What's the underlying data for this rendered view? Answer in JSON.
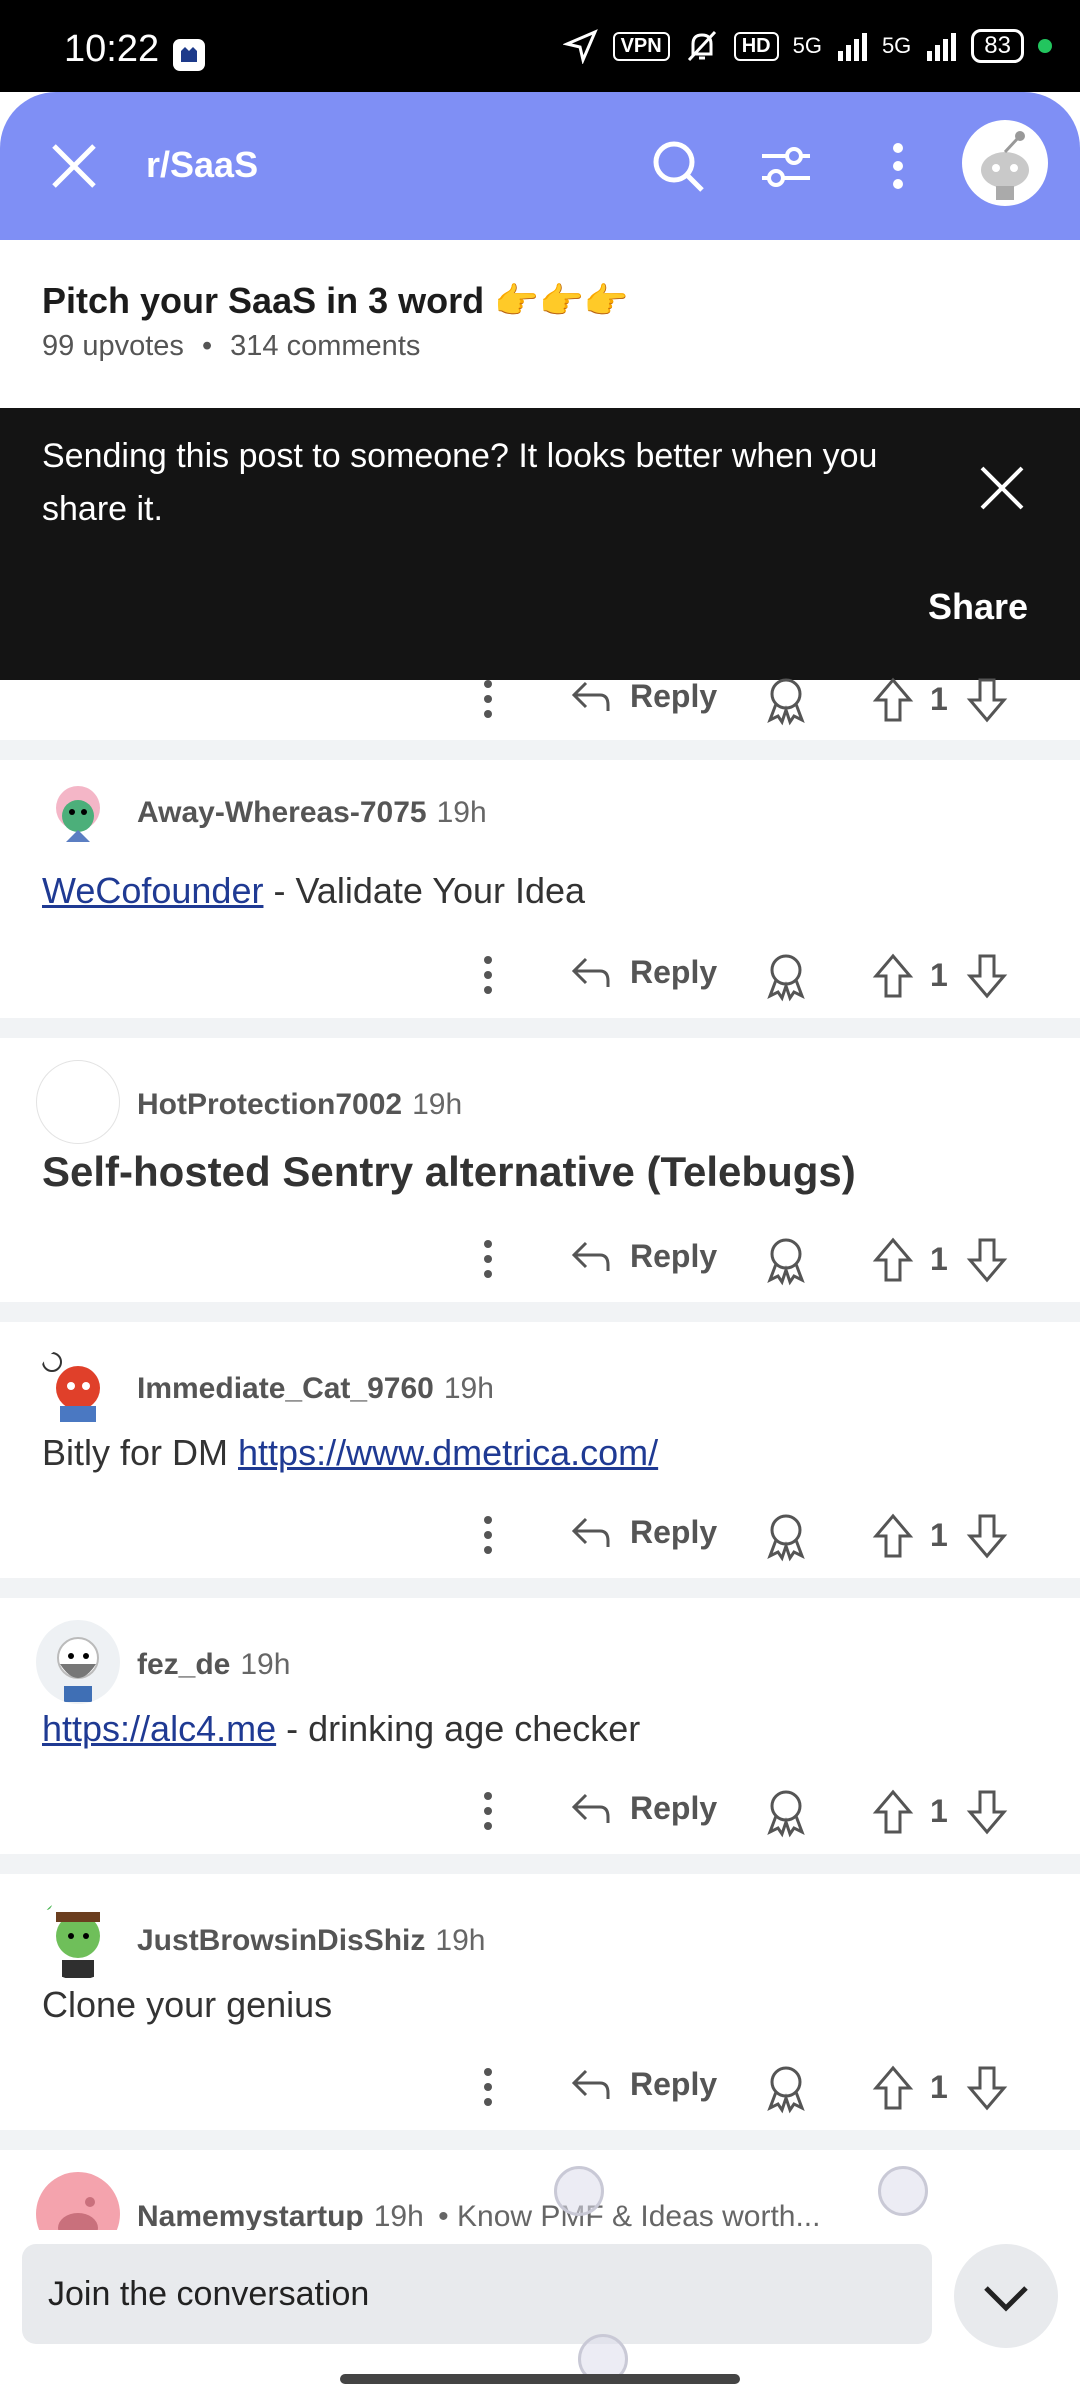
{
  "status_bar": {
    "time": "10:22",
    "vpn": "VPN",
    "hd": "HD",
    "network": "5G",
    "battery": "83"
  },
  "header": {
    "title": "r/SaaS",
    "accent_color": "#7f8ff5"
  },
  "post": {
    "title": "Pitch your SaaS in 3 word",
    "title_emoji": "👉👉👉",
    "upvotes": "99 upvotes",
    "separator": "•",
    "comments": "314 comments"
  },
  "toast": {
    "message": "Sending this post to someone? It looks better when you share it.",
    "share_label": "Share"
  },
  "actions": {
    "reply_label": "Reply"
  },
  "comments": [
    {
      "username": "",
      "time": "",
      "body": "",
      "score": "1"
    },
    {
      "username": "Away-Whereas-7075",
      "time": "19h",
      "body_link": "WeCofounder",
      "body_text": " - Validate Your Idea",
      "score": "1"
    },
    {
      "username": "HotProtection7002",
      "time": "19h",
      "body": "Self-hosted Sentry alternative (Telebugs)",
      "score": "1"
    },
    {
      "username": "Immediate_Cat_9760",
      "time": "19h",
      "body_text": "Bitly for DM ",
      "body_link": "https://www.dmetrica.com/",
      "score": "1"
    },
    {
      "username": "fez_de",
      "time": "19h",
      "body_link": "https://alc4.me",
      "body_text": " - drinking age checker",
      "score": "1"
    },
    {
      "username": "JustBrowsinDisShiz",
      "time": "19h",
      "body": "Clone your genius",
      "score": "1"
    },
    {
      "username": "Namemystartup",
      "time": "19h",
      "flair": "• Know PMF & Ideas worth..."
    }
  ],
  "composer": {
    "placeholder": "Join the conversation"
  }
}
